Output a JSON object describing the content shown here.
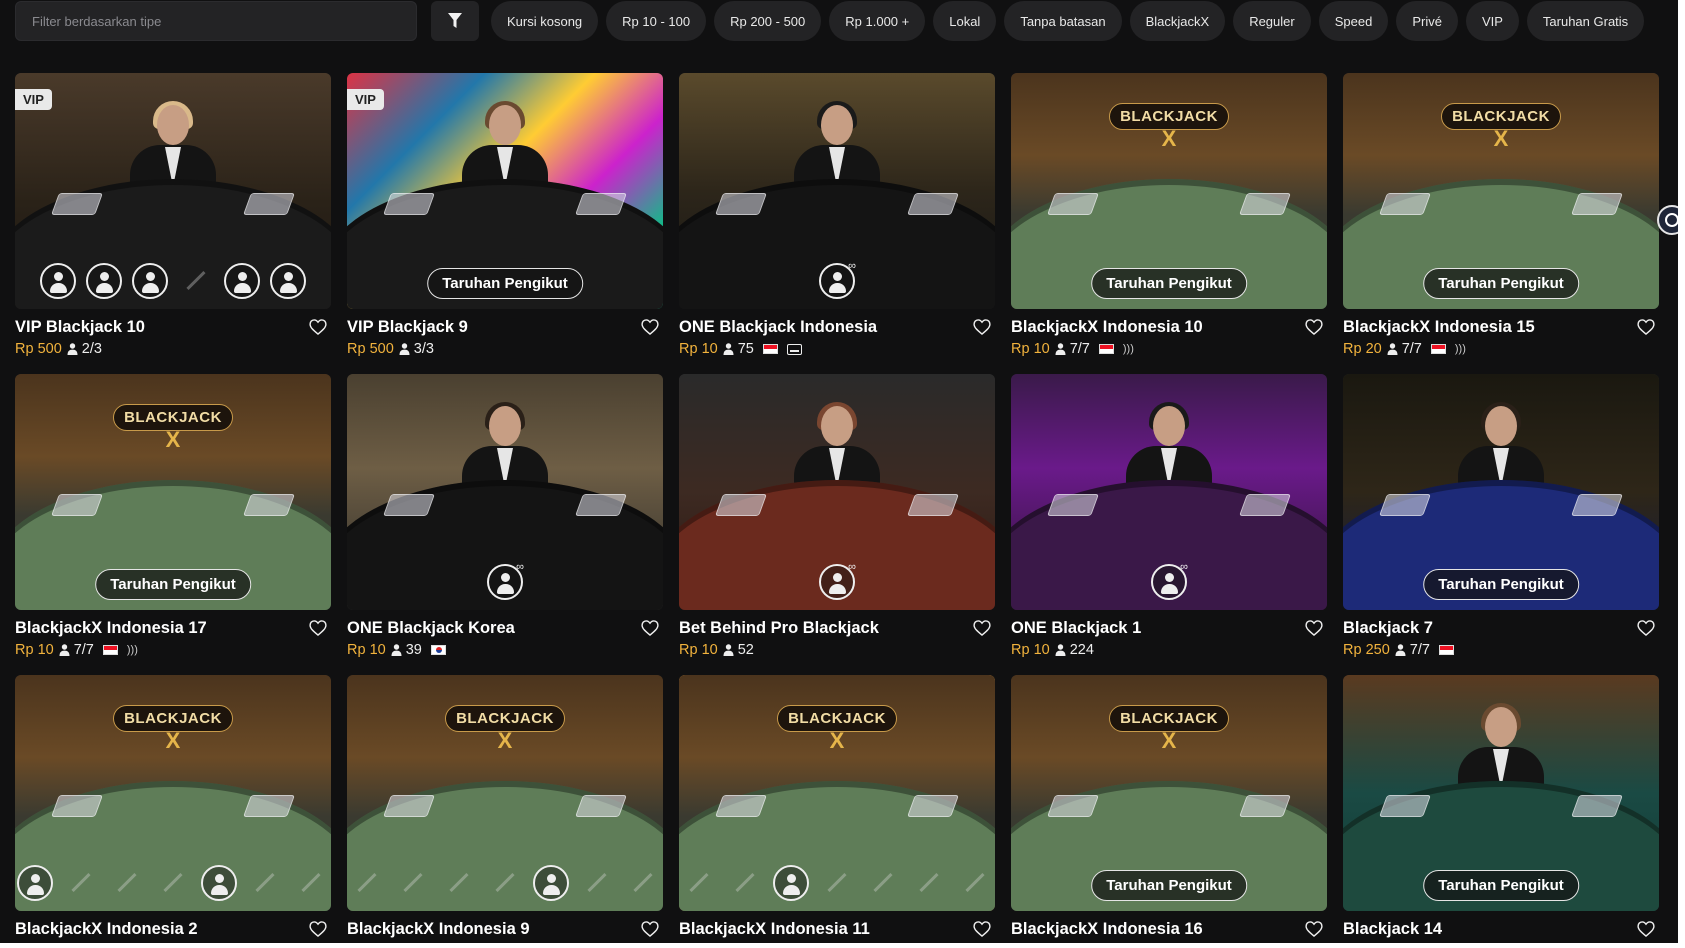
{
  "filter": {
    "placeholder": "Filter berdasarkan tipe",
    "chips": [
      "Kursi kosong",
      "Rp 10 - 100",
      "Rp 200 - 500",
      "Rp 1.000 +",
      "Lokal",
      "Tanpa batasan",
      "BlackjackX",
      "Reguler",
      "Speed",
      "Privé",
      "VIP",
      "Taruhan Gratis"
    ]
  },
  "games": [
    {
      "title": "VIP Blackjack 10",
      "stake": "Rp 500",
      "players": "2/3",
      "badge": "VIP",
      "scene": "vip",
      "overlay": "seats",
      "seats": [
        1,
        1,
        1,
        0,
        1,
        1
      ],
      "flag": "",
      "captions": false,
      "sound": false
    },
    {
      "title": "VIP Blackjack 9",
      "stake": "Rp 500",
      "players": "3/3",
      "badge": "VIP",
      "scene": "art",
      "overlay": "follow",
      "flag": "",
      "captions": false,
      "sound": false
    },
    {
      "title": "ONE Blackjack Indonesia",
      "stake": "Rp 10",
      "players": "75",
      "badge": "",
      "scene": "dark",
      "overlay": "infinite",
      "flag": "id",
      "captions": true,
      "sound": false
    },
    {
      "title": "BlackjackX Indonesia 10",
      "stake": "Rp 10",
      "players": "7/7",
      "badge": "",
      "scene": "bjx",
      "overlay": "follow",
      "flag": "id",
      "captions": false,
      "sound": true
    },
    {
      "title": "BlackjackX Indonesia 15",
      "stake": "Rp 20",
      "players": "7/7",
      "badge": "",
      "scene": "bjx",
      "overlay": "follow",
      "flag": "id",
      "captions": false,
      "sound": true
    },
    {
      "title": "BlackjackX Indonesia 17",
      "stake": "Rp 10",
      "players": "7/7",
      "badge": "",
      "scene": "bjx",
      "overlay": "follow",
      "flag": "id",
      "captions": false,
      "sound": true
    },
    {
      "title": "ONE Blackjack Korea",
      "stake": "Rp 10",
      "players": "39",
      "badge": "",
      "scene": "korea",
      "overlay": "infinite",
      "flag": "kr",
      "captions": false,
      "sound": false
    },
    {
      "title": "Bet Behind Pro Blackjack",
      "stake": "Rp 10",
      "players": "52",
      "badge": "",
      "scene": "red",
      "overlay": "infinite",
      "flag": "",
      "captions": false,
      "sound": false
    },
    {
      "title": "ONE Blackjack 1",
      "stake": "Rp 10",
      "players": "224",
      "badge": "",
      "scene": "purple",
      "overlay": "infinite",
      "flag": "",
      "captions": false,
      "sound": false
    },
    {
      "title": "Blackjack 7",
      "stake": "Rp 250",
      "players": "7/7",
      "badge": "",
      "scene": "blue",
      "overlay": "follow",
      "flag": "id",
      "captions": false,
      "sound": false
    },
    {
      "title": "BlackjackX Indonesia 2",
      "stake": "",
      "players": "",
      "badge": "",
      "scene": "bjx",
      "overlay": "seats",
      "seats": [
        1,
        0,
        0,
        0,
        1,
        0,
        0
      ],
      "flag": "",
      "captions": false,
      "sound": false
    },
    {
      "title": "BlackjackX Indonesia 9",
      "stake": "",
      "players": "",
      "badge": "",
      "scene": "bjx",
      "overlay": "seats",
      "seats": [
        0,
        0,
        0,
        0,
        1,
        0,
        0
      ],
      "flag": "",
      "captions": false,
      "sound": false
    },
    {
      "title": "BlackjackX Indonesia 11",
      "stake": "",
      "players": "",
      "badge": "",
      "scene": "bjx",
      "overlay": "seats",
      "seats": [
        0,
        0,
        1,
        0,
        0,
        0,
        0
      ],
      "flag": "",
      "captions": false,
      "sound": false,
      "selected": true
    },
    {
      "title": "BlackjackX Indonesia 16",
      "stake": "",
      "players": "",
      "badge": "",
      "scene": "bjx",
      "overlay": "follow",
      "flag": "",
      "captions": false,
      "sound": false
    },
    {
      "title": "Blackjack 14",
      "stake": "",
      "players": "",
      "badge": "",
      "scene": "teal",
      "overlay": "follow",
      "flag": "",
      "captions": false,
      "sound": false
    }
  ],
  "strings": {
    "follow_label": "Taruhan Pengikut",
    "bj_logo_word": "BLACKJACK",
    "bj_logo_x": "X",
    "infinity": "∞"
  },
  "colors": {
    "page_bg": "#101011",
    "chip_bg": "#232325",
    "stake": "#f2b33d",
    "selected_border": "#f0a23a"
  },
  "icons": {
    "filter": "funnel-icon",
    "favorite": "heart-outline-icon",
    "players": "person-icon",
    "side": "target-icon"
  }
}
